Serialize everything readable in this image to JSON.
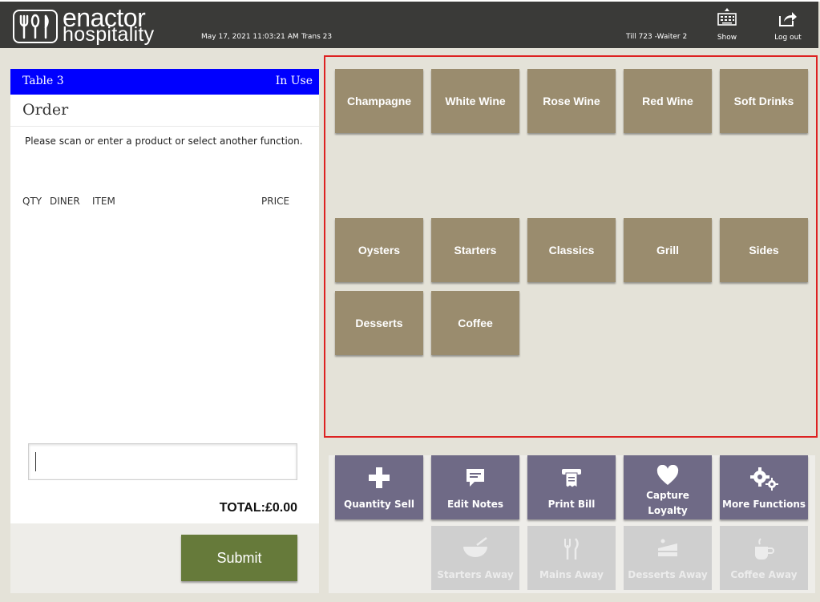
{
  "header": {
    "brand_line1": "enactor",
    "brand_line2": "hospitality",
    "datetime": "May 17, 2021 11:03:21 AM",
    "trans": "Trans 23",
    "till": "Till 723 -Waiter 2",
    "show_label": "Show",
    "logout_label": "Log out"
  },
  "order": {
    "table_name": "Table 3",
    "table_status": "In Use",
    "title": "Order",
    "prompt": "Please scan or enter a product or select another function.",
    "columns": {
      "qty": "QTY",
      "diner": "DINER",
      "item": "ITEM",
      "price": "PRICE"
    },
    "scan_value": "",
    "total": "TOTAL:£0.00",
    "submit_label": "Submit"
  },
  "categories": [
    "Champagne",
    "White Wine",
    "Rose Wine",
    "Red Wine",
    "Soft Drinks",
    "Oysters",
    "Starters",
    "Classics",
    "Grill",
    "Sides",
    "Desserts",
    "Coffee"
  ],
  "functions": [
    {
      "label": "Quantity Sell",
      "icon": "plus-icon",
      "enabled": true
    },
    {
      "label": "Edit Notes",
      "icon": "notes-icon",
      "enabled": true
    },
    {
      "label": "Print Bill",
      "icon": "receipt-icon",
      "enabled": true
    },
    {
      "label": "Capture Loyalty",
      "icon": "heart-icon",
      "enabled": true
    },
    {
      "label": "More Functions",
      "icon": "gears-icon",
      "enabled": true
    },
    {
      "label": "Starters Away",
      "icon": "bowl-icon",
      "enabled": false
    },
    {
      "label": "Mains Away",
      "icon": "cutlery-icon",
      "enabled": false
    },
    {
      "label": "Desserts Away",
      "icon": "cake-icon",
      "enabled": false
    },
    {
      "label": "Coffee Away",
      "icon": "cup-icon",
      "enabled": false
    }
  ],
  "colors": {
    "header_bg": "#3a3a38",
    "table_bar": "#0000ff",
    "category_btn": "#9a8c6e",
    "function_btn": "#6f6a86",
    "submit_btn": "#667a3a",
    "highlight_border": "#dd2222"
  }
}
